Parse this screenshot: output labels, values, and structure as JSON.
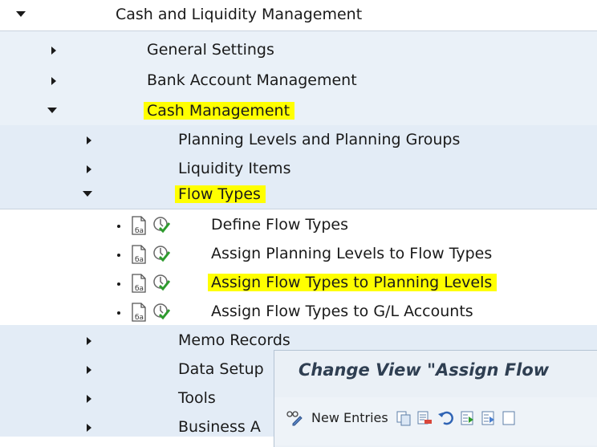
{
  "tree": {
    "root": {
      "label": "Cash and Liquidity Management"
    },
    "level1": [
      {
        "label": "General Settings"
      },
      {
        "label": "Bank Account Management"
      },
      {
        "label": "Cash Management"
      }
    ],
    "level2": [
      {
        "label": "Planning Levels and Planning Groups"
      },
      {
        "label": "Liquidity Items"
      },
      {
        "label": "Flow Types"
      }
    ],
    "activities": [
      {
        "label": "Define Flow Types"
      },
      {
        "label": "Assign Planning Levels to Flow Types"
      },
      {
        "label": "Assign Flow Types to Planning Levels"
      },
      {
        "label": "Assign Flow Types to G/L Accounts"
      }
    ],
    "level2_after": [
      {
        "label": "Memo Records"
      },
      {
        "label": "Data Setup"
      },
      {
        "label": "Tools"
      },
      {
        "label": "Business A"
      }
    ]
  },
  "popup": {
    "title": "Change View \"Assign Flow",
    "new_entries_label": "New Entries"
  },
  "colors": {
    "highlight": "#ffff00",
    "node_separator": "#c9d3de"
  },
  "icons": {
    "expanded": "triangle-down-icon",
    "collapsed": "triangle-right-icon",
    "activity_doc": "documentation-icon",
    "activity_exec": "execute-check-icon"
  }
}
